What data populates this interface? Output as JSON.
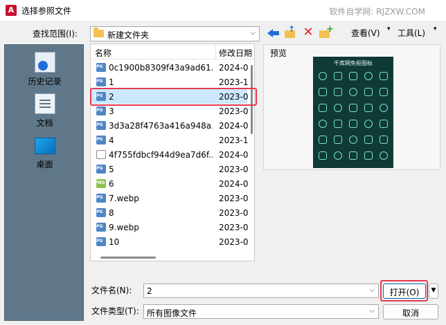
{
  "window": {
    "title": "选择参照文件",
    "app_icon_letter": "A",
    "watermark": "软件自学网: RJZXW.COM"
  },
  "lookin": {
    "label": "查找范围(I):",
    "value": "新建文件夹"
  },
  "toolbar": {
    "view_label": "查看(V)",
    "tools_label": "工具(L)"
  },
  "places": [
    {
      "label": "历史记录",
      "icon": "history-icon"
    },
    {
      "label": "文档",
      "icon": "documents-icon"
    },
    {
      "label": "桌面",
      "icon": "desktop-icon"
    }
  ],
  "filelist": {
    "col_name": "名称",
    "col_date": "修改日期",
    "rows": [
      {
        "name": "0c1900b8309f43a9ad61...",
        "date": "2024-0",
        "type": "jpg"
      },
      {
        "name": "1",
        "date": "2023-1",
        "type": "jpg"
      },
      {
        "name": "2",
        "date": "2023-0",
        "type": "jpg",
        "selected": true
      },
      {
        "name": "3",
        "date": "2023-0",
        "type": "jpg"
      },
      {
        "name": "3d3a28f4763a416a948a...",
        "date": "2024-0",
        "type": "jpg"
      },
      {
        "name": "4",
        "date": "2023-1",
        "type": "jpg"
      },
      {
        "name": "4f755fdbcf944d9ea7d6f...",
        "date": "2024-0",
        "type": "blank"
      },
      {
        "name": "5",
        "date": "2023-0",
        "type": "jpg"
      },
      {
        "name": "6",
        "date": "2024-0",
        "type": "png"
      },
      {
        "name": "7.webp",
        "date": "2023-0",
        "type": "jpg"
      },
      {
        "name": "8",
        "date": "2023-0",
        "type": "jpg"
      },
      {
        "name": "9.webp",
        "date": "2023-0",
        "type": "jpg"
      },
      {
        "name": "10",
        "date": "2023-0",
        "type": "jpg"
      }
    ]
  },
  "preview": {
    "label": "预览",
    "image_title": "千库网免抠图标"
  },
  "filename": {
    "label": "文件名(N):",
    "value": "2"
  },
  "filetype": {
    "label": "文件类型(T):",
    "value": "所有图像文件"
  },
  "buttons": {
    "open": "打开(O)",
    "cancel": "取消"
  },
  "colors": {
    "selection": "#cce8ff",
    "highlight_box": "#e53950",
    "places_bg": "#5f7789",
    "preview_bg": "#0f3a36"
  }
}
